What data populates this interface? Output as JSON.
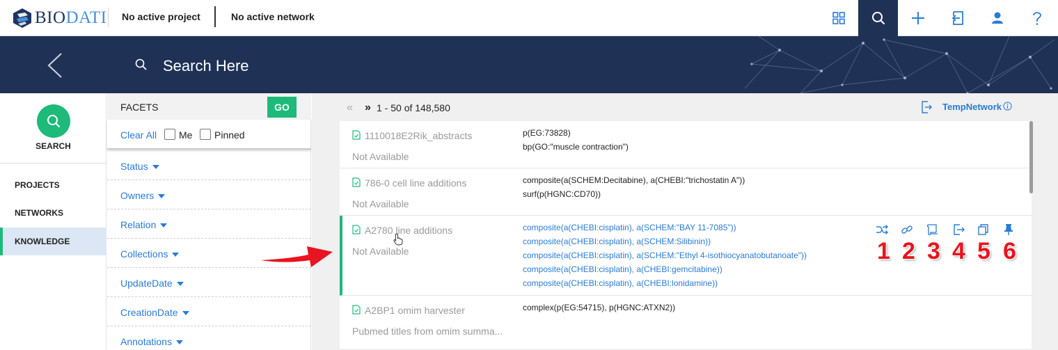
{
  "app": {
    "logo_bio": "BIO",
    "logo_dati": "DATI",
    "project": "No active project",
    "network": "No active network"
  },
  "topbar_icons": [
    "grid-icon",
    "search-icon",
    "plus-icon",
    "sign-in-icon",
    "user-icon",
    "help-icon"
  ],
  "banner": {
    "search_placeholder": "Search Here"
  },
  "leftnav": {
    "search_label": "SEARCH",
    "items": [
      "PROJECTS",
      "NETWORKS",
      "KNOWLEDGE"
    ],
    "active": "KNOWLEDGE"
  },
  "facets": {
    "title": "FACETS",
    "go": "GO",
    "clear_all": "Clear All",
    "me": "Me",
    "pinned": "Pinned",
    "rows": [
      "Status",
      "Owners",
      "Relation",
      "Collections",
      "UpdateDate",
      "CreationDate",
      "Annotations"
    ]
  },
  "results": {
    "pager_prev": "«",
    "pager_next": "»",
    "range": "1 - 50 of 148,580",
    "temp_network": "TempNetwork",
    "cards": [
      {
        "title": "1110018E2Rik_abstracts",
        "desc": "Not Available",
        "statements": [
          "p(EG:73828)",
          "bp(GO:\"muscle contraction\")"
        ]
      },
      {
        "title": "786-0 cell line additions",
        "desc": "Not Available",
        "statements": [
          "composite(a(SCHEM:Decitabine), a(CHEBI:\"trichostatin A\"))",
          "surf(p(HGNC:CD70))"
        ]
      },
      {
        "title": "A2780 line additions",
        "desc": "Not Available",
        "statements": [
          "composite(a(CHEBI:cisplatin), a(SCHEM:\"BAY 11-7085\"))",
          "composite(a(CHEBI:cisplatin), a(SCHEM:Silibinin))",
          "composite(a(CHEBI:cisplatin), a(SCHEM:\"Ethyl 4-isothiocyanatobutanoate\"))",
          "composite(a(CHEBI:cisplatin), a(CHEBI:gemcitabine))",
          "composite(a(CHEBI:cisplatin), a(CHEBI:lonidamine))"
        ]
      },
      {
        "title": "A2BP1 omim harvester",
        "desc": "Pubmed titles from omim summa...",
        "statements": [
          "complex(p(EG:54715), p(HGNC:ATXN2))"
        ]
      }
    ],
    "action_icons": [
      "shuffle-icon",
      "link-icon",
      "scroll-icon",
      "export-icon",
      "copy-icon",
      "pin-icon"
    ],
    "action_numbers": [
      "1",
      "2",
      "3",
      "4",
      "5",
      "6"
    ]
  },
  "colors": {
    "navy": "#1f3256",
    "green": "#1dba7a",
    "link_blue": "#2a7bd4",
    "annotation_red": "#e8141f"
  }
}
